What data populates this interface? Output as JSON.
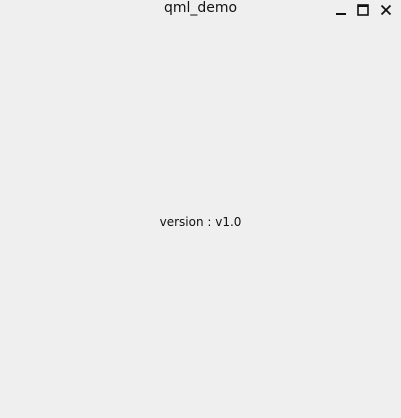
{
  "window": {
    "title": "qml_demo",
    "controls": {
      "minimize_icon": "minimize-icon",
      "maximize_icon": "maximize-icon",
      "close_icon": "close-icon"
    }
  },
  "content": {
    "version_text": "version : v1.0"
  },
  "colors": {
    "background": "#efefef",
    "text": "#111111"
  }
}
